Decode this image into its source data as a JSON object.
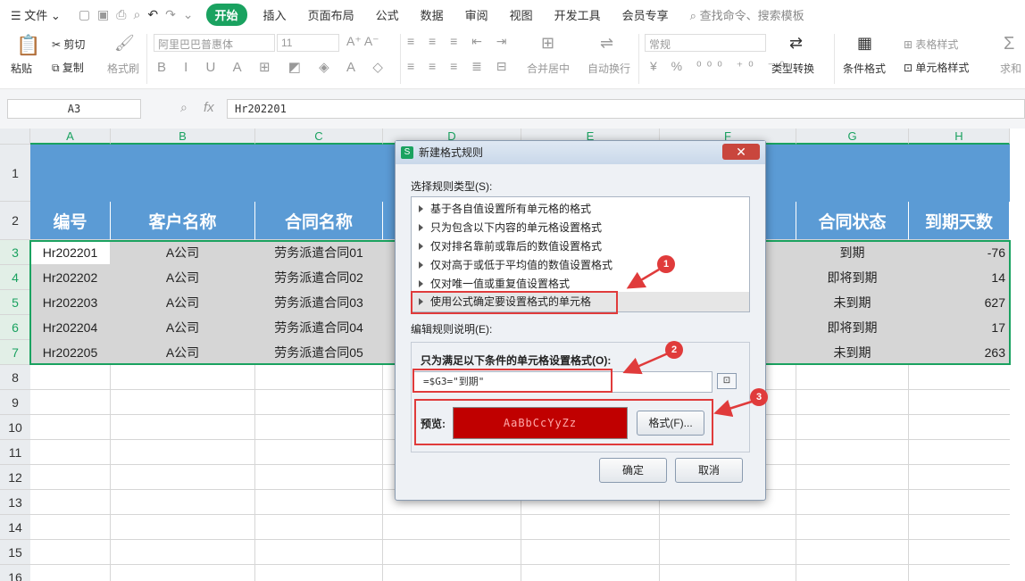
{
  "menubar": {
    "file": "文件",
    "tabs": [
      "开始",
      "插入",
      "页面布局",
      "公式",
      "数据",
      "审阅",
      "视图",
      "开发工具",
      "会员专享"
    ],
    "search": "查找命令、搜索模板"
  },
  "toolbar": {
    "paste": "粘贴",
    "cut": "剪切",
    "copy": "复制",
    "format_painter": "格式刷",
    "font": "阿里巴巴普惠体",
    "size": "11",
    "merge": "合并居中",
    "wrap": "自动换行",
    "num_format": "常规",
    "type_convert": "类型转换",
    "cond_format": "条件格式",
    "table_style": "表格样式",
    "cell_style": "单元格样式",
    "sum": "求和"
  },
  "formula_bar": {
    "name_box": "A3",
    "fx": "fx",
    "value": "Hr202201"
  },
  "sheet": {
    "columns": [
      "A",
      "B",
      "C",
      "D",
      "E",
      "F",
      "G",
      "H"
    ],
    "rows": [
      "1",
      "2",
      "3",
      "4",
      "5",
      "6",
      "7",
      "8",
      "9",
      "10",
      "11",
      "12",
      "13",
      "14",
      "15",
      "16"
    ],
    "headers": [
      "编号",
      "客户名称",
      "合同名称",
      "合同状态",
      "到期天数"
    ],
    "data": [
      {
        "id": "Hr202201",
        "client": "A公司",
        "contract": "劳务派遣合同01",
        "status": "到期",
        "days": "-76"
      },
      {
        "id": "Hr202202",
        "client": "A公司",
        "contract": "劳务派遣合同02",
        "status": "即将到期",
        "days": "14"
      },
      {
        "id": "Hr202203",
        "client": "A公司",
        "contract": "劳务派遣合同03",
        "status": "未到期",
        "days": "627"
      },
      {
        "id": "Hr202204",
        "client": "A公司",
        "contract": "劳务派遣合同04",
        "status": "即将到期",
        "days": "17"
      },
      {
        "id": "Hr202205",
        "client": "A公司",
        "contract": "劳务派遣合同05",
        "status": "未到期",
        "days": "263"
      }
    ]
  },
  "dialog": {
    "title": "新建格式规则",
    "select_type_label": "选择规则类型(S):",
    "rule_types": [
      "基于各自值设置所有单元格的格式",
      "只为包含以下内容的单元格设置格式",
      "仅对排名靠前或靠后的数值设置格式",
      "仅对高于或低于平均值的数值设置格式",
      "仅对唯一值或重复值设置格式",
      "使用公式确定要设置格式的单元格"
    ],
    "edit_desc_label": "编辑规则说明(E):",
    "condition_label": "只为满足以下条件的单元格设置格式(O):",
    "formula": "=$G3=\"到期\"",
    "preview_label": "预览:",
    "preview_text": "AaBbCcYyZz",
    "format_button": "格式(F)...",
    "ok": "确定",
    "cancel": "取消"
  },
  "annotations": {
    "badges": [
      "1",
      "2",
      "3"
    ],
    "color": "#e03b3b"
  },
  "colors": {
    "accent": "#1aa260",
    "header_blue": "#5b9bd5",
    "preview_red": "#c00000"
  }
}
